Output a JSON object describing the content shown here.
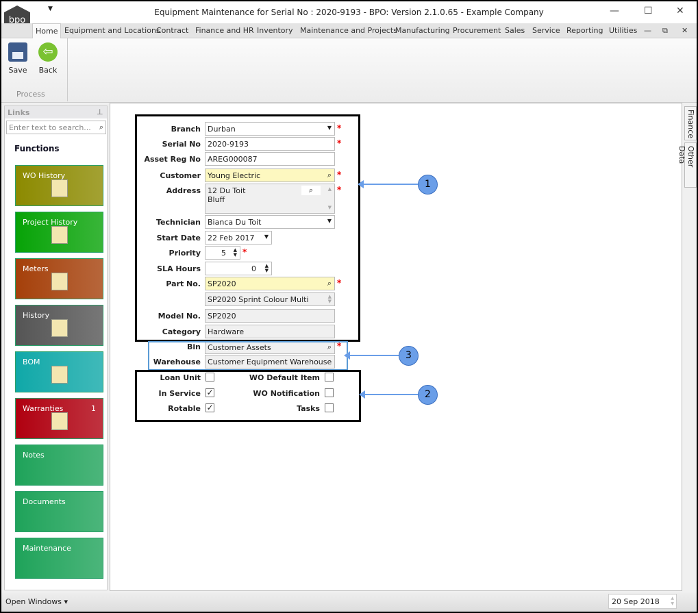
{
  "window": {
    "title": "Equipment Maintenance for Serial No : 2020-9193 - BPO: Version 2.1.0.65 - Example Company",
    "logo": "bpo"
  },
  "menu_tabs": [
    "Home",
    "Equipment and Locations",
    "Contract",
    "Finance and HR",
    "Inventory",
    "Maintenance and Projects",
    "Manufacturing",
    "Procurement",
    "Sales",
    "Service",
    "Reporting",
    "Utilities"
  ],
  "ribbon": {
    "save": "Save",
    "back": "Back",
    "group": "Process"
  },
  "links": {
    "title": "Links",
    "search_placeholder": "Enter text to search...",
    "functions": "Functions",
    "tiles": [
      {
        "label": "WO History",
        "color": "#8c8a00"
      },
      {
        "label": "Project History",
        "color": "#07a307"
      },
      {
        "label": "Meters",
        "color": "#a5400a"
      },
      {
        "label": "History",
        "color": "#555555"
      },
      {
        "label": "BOM",
        "color": "#10a8a8"
      },
      {
        "label": "Warranties",
        "badge": "1",
        "color": "#b00010"
      },
      {
        "label": "Notes",
        "color": "#1fa35a"
      },
      {
        "label": "Documents",
        "color": "#1fa35a"
      },
      {
        "label": "Maintenance",
        "color": "#1fa35a"
      }
    ]
  },
  "form": {
    "branch": {
      "label": "Branch",
      "value": "Durban"
    },
    "serial": {
      "label": "Serial No",
      "value": "2020-9193"
    },
    "asset": {
      "label": "Asset Reg No",
      "value": "AREG000087"
    },
    "customer": {
      "label": "Customer",
      "value": "Young Electric"
    },
    "address": {
      "label": "Address",
      "line1": "12 Du Toit",
      "line2": "Bluff"
    },
    "technician": {
      "label": "Technician",
      "value": "Bianca Du Toit"
    },
    "start": {
      "label": "Start Date",
      "value": "22 Feb 2017"
    },
    "priority": {
      "label": "Priority",
      "value": "5"
    },
    "sla": {
      "label": "SLA Hours",
      "value": "0"
    },
    "part": {
      "label": "Part No.",
      "value": "SP2020",
      "description": "SP2020 Sprint Colour Multi"
    },
    "model": {
      "label": "Model No.",
      "value": "SP2020"
    },
    "category": {
      "label": "Category",
      "value": "Hardware"
    },
    "bin": {
      "label": "Bin",
      "value": "Customer Assets"
    },
    "warehouse": {
      "label": "Warehouse",
      "value": "Customer Equipment Warehouse"
    },
    "loan": {
      "label": "Loan Unit",
      "checked": false
    },
    "inservice": {
      "label": "In Service",
      "checked": true
    },
    "rotable": {
      "label": "Rotable",
      "checked": true
    },
    "wodefault": {
      "label": "WO Default Item",
      "checked": false
    },
    "wonotif": {
      "label": "WO Notification",
      "checked": false
    },
    "tasks": {
      "label": "Tasks",
      "checked": false
    },
    "required_mark": "*"
  },
  "callouts": [
    "1",
    "3",
    "2"
  ],
  "side_tabs": [
    "Finance",
    "Other Data"
  ],
  "status": {
    "open_windows": "Open Windows",
    "date": "20 Sep 2018"
  }
}
